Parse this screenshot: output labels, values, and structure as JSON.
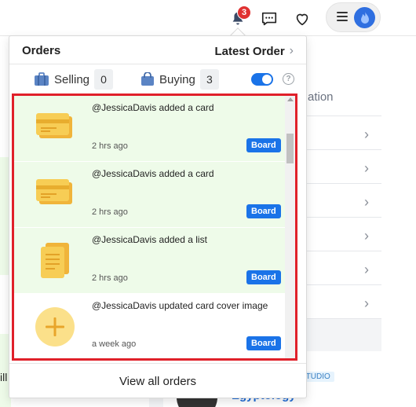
{
  "topbar": {
    "bell_badge_count": "3",
    "icons": [
      "bell-icon",
      "chat-icon",
      "heart-icon",
      "menu-icon",
      "avatar-flame-icon"
    ]
  },
  "background": {
    "left_partial_text": "ill",
    "right_header_text": "ation",
    "tag_text": "STUDIO",
    "link_text": "Egyptology",
    "row_chevron": "›"
  },
  "orders_panel": {
    "title": "Orders",
    "latest_order_label": "Latest Order",
    "chevron": "›",
    "filters": {
      "selling_label": "Selling",
      "selling_count": "0",
      "buying_label": "Buying",
      "buying_count": "3",
      "toggle_on": true,
      "help_glyph": "?"
    },
    "notifications": [
      {
        "text": "@JessicaDavis added a card",
        "time": "2 hrs ago",
        "badge": "Board",
        "icon": "card-icon",
        "unread": true
      },
      {
        "text": "@JessicaDavis added a card",
        "time": "2 hrs ago",
        "badge": "Board",
        "icon": "card-icon",
        "unread": true
      },
      {
        "text": "@JessicaDavis added a list",
        "time": "2 hrs ago",
        "badge": "Board",
        "icon": "list-icon",
        "unread": true
      },
      {
        "text": "@JessicaDavis updated card cover image",
        "time": "a week ago",
        "badge": "Board",
        "icon": "plus-circle-icon",
        "unread": false
      }
    ],
    "footer_label": "View all orders"
  },
  "colors": {
    "accent_blue": "#1a73e8",
    "badge_red": "#e03131",
    "highlight_border": "#e0202a",
    "unread_bg": "#eefbe9",
    "icon_yellow": "#f5c542"
  }
}
